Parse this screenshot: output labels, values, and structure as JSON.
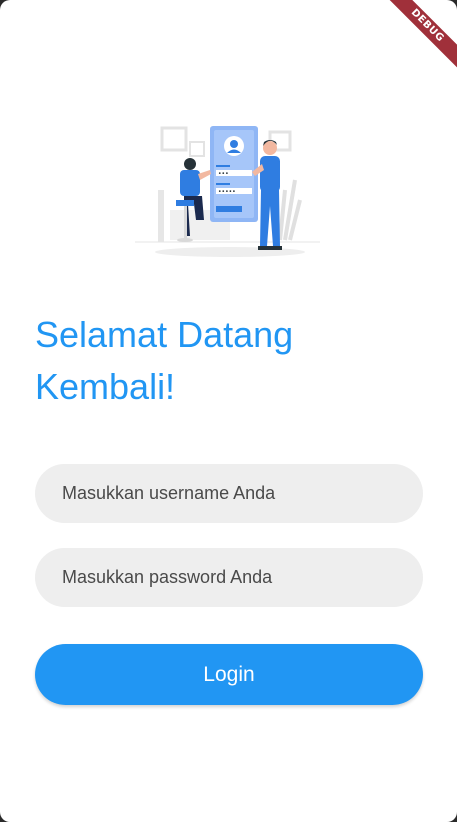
{
  "debug_banner": {
    "label": "DEBUG"
  },
  "illustration": {
    "name": "login-illustration"
  },
  "header": {
    "title": "Selamat Datang Kembali!"
  },
  "form": {
    "username_placeholder": "Masukkan username Anda",
    "password_placeholder": "Masukkan password Anda",
    "login_label": "Login"
  },
  "colors": {
    "accent": "#2196f3",
    "field_background": "#eeeeee",
    "debug_ribbon": "#a0303a"
  }
}
